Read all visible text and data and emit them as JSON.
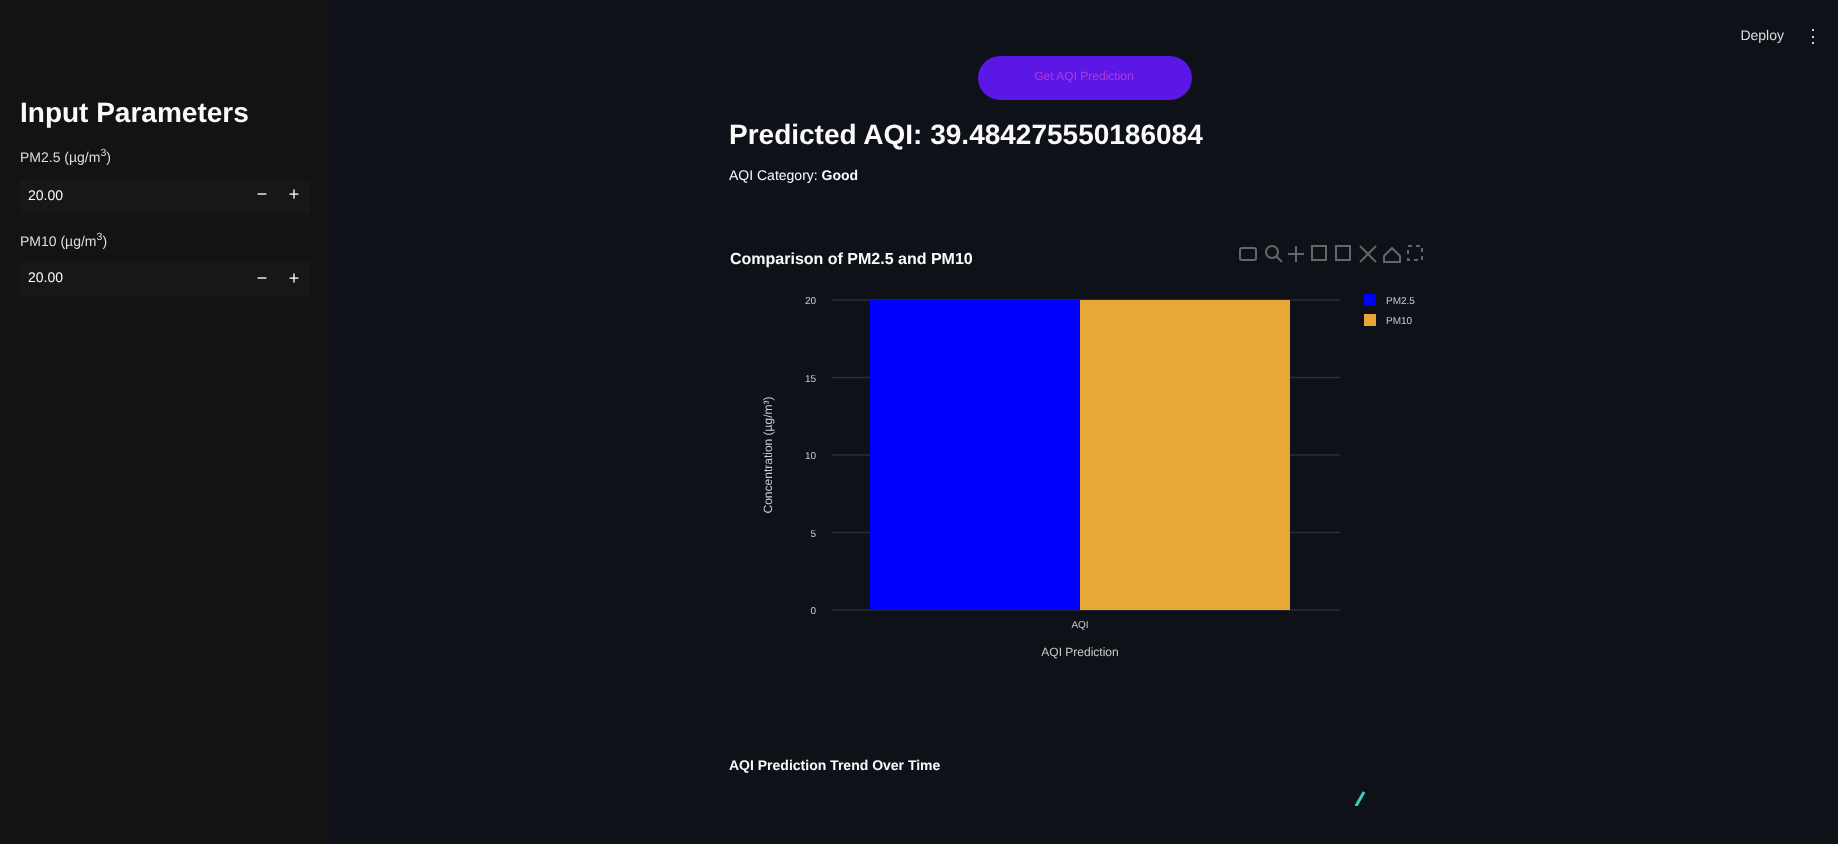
{
  "header": {
    "deploy": "Deploy",
    "menu": "⋮"
  },
  "sidebar": {
    "title": "Input Parameters",
    "inputs": [
      {
        "label": "PM2.5 (µg/m$^{3}$)",
        "value": "20.00",
        "minus": "−",
        "plus": "+"
      },
      {
        "label": "PM10 (µg/m$^{3}$)",
        "value": "20.00",
        "minus": "−",
        "plus": "+"
      }
    ]
  },
  "button": "Get AQI Prediction",
  "result": {
    "heading": "Predicted AQI: 39.484275550186084",
    "category_label": "AQI Category: ",
    "category": "Good"
  },
  "chart": {
    "chart_data": {
      "type": "bar",
      "title": "Comparison of PM2.5 and PM10",
      "xlabel": "AQI Prediction",
      "ylabel": "Concentration (µg/m³)",
      "categories": [
        "AQI"
      ],
      "series": [
        {
          "name": "PM2.5",
          "color": "#0000ff",
          "values": [
            20
          ]
        },
        {
          "name": "PM10",
          "color": "#e8a838",
          "values": [
            20
          ]
        }
      ],
      "ylim": [
        0,
        20
      ],
      "yticks": [
        0,
        5,
        10,
        15,
        20
      ],
      "grid": true,
      "legend": true
    }
  },
  "trend": {
    "title": "AQI Prediction Trend Over Time"
  }
}
